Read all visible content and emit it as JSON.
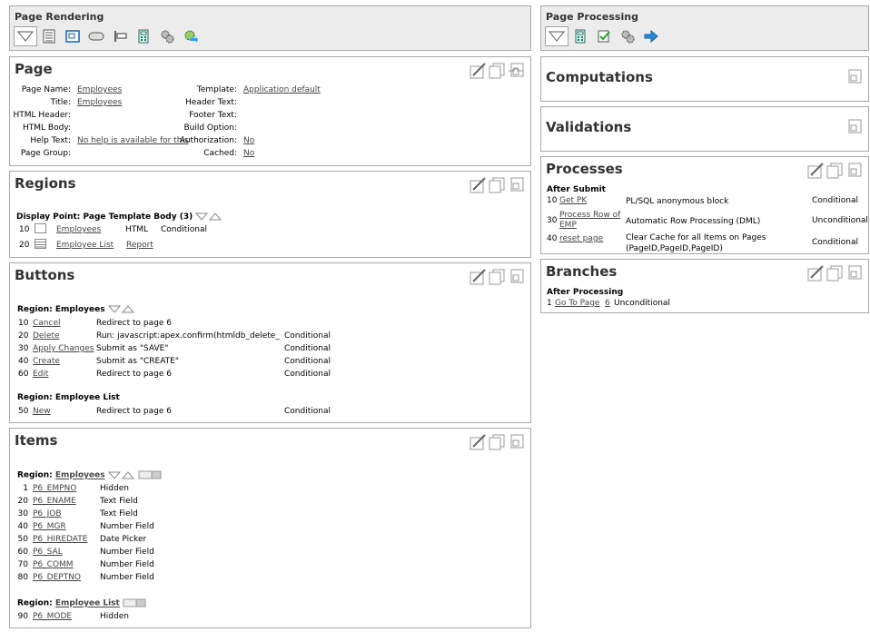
{
  "rendering": {
    "title": "Page Rendering",
    "toolbar_icons": [
      "view-icon",
      "page-list-icon",
      "region-icon",
      "button-icon",
      "item-icon",
      "calculator-icon",
      "gear-icon",
      "shared-components-icon"
    ]
  },
  "processing": {
    "title": "Page Processing",
    "toolbar_icons": [
      "view-icon",
      "calculator-icon",
      "validation-icon",
      "gear-icon",
      "arrow-right-icon"
    ]
  },
  "page": {
    "title": "Page",
    "left": [
      {
        "label": "Page Name:",
        "value": "Employees",
        "link": true
      },
      {
        "label": "Title:",
        "value": "Employees",
        "link": true
      },
      {
        "label": "HTML Header:",
        "value": "",
        "link": false
      },
      {
        "label": "HTML Body:",
        "value": "",
        "link": false
      },
      {
        "label": "Help Text:",
        "value": "No help is available for this",
        "link": true
      },
      {
        "label": "Page Group:",
        "value": "",
        "link": false
      }
    ],
    "right": [
      {
        "label": "Template:",
        "value": "Application default",
        "link": true
      },
      {
        "label": "Header Text:",
        "value": "",
        "link": false
      },
      {
        "label": "Footer Text:",
        "value": "",
        "link": false
      },
      {
        "label": "Build Option:",
        "value": "",
        "link": false
      },
      {
        "label": "Authorization:",
        "value": "No",
        "link": true
      },
      {
        "label": "Cached:",
        "value": "No",
        "link": true
      }
    ]
  },
  "regions": {
    "title": "Regions",
    "display_point": "Display Point: Page Template Body (3)",
    "rows": [
      {
        "seq": "10",
        "name": "Employees",
        "type": "HTML",
        "extra": "Conditional",
        "extra_link": false
      },
      {
        "seq": "20",
        "name": "Employee List",
        "type": "",
        "extra": "Report",
        "extra_link": true
      }
    ]
  },
  "buttons": {
    "title": "Buttons",
    "group1": "Region: Employees",
    "rows1": [
      {
        "seq": "10",
        "name": "Cancel",
        "action": "Redirect to page 6",
        "cond": ""
      },
      {
        "seq": "20",
        "name": "Delete",
        "action": "Run: javascript:apex.confirm(htmldb_delete_me",
        "cond": "Conditional"
      },
      {
        "seq": "30",
        "name": "Apply Changes",
        "action": "Submit as \"SAVE\"",
        "cond": "Conditional"
      },
      {
        "seq": "40",
        "name": "Create",
        "action": "Submit as \"CREATE\"",
        "cond": "Conditional"
      },
      {
        "seq": "60",
        "name": "Edit",
        "action": "Redirect to page 6",
        "cond": "Conditional"
      }
    ],
    "group2": "Region: Employee List",
    "rows2": [
      {
        "seq": "50",
        "name": "New",
        "action": "Redirect to page 6",
        "cond": "Conditional"
      }
    ]
  },
  "items": {
    "title": "Items",
    "group1_prefix": "Region:",
    "group1_name": "Employees",
    "rows1": [
      {
        "seq": "1",
        "name": "P6_EMPNO",
        "type": "Hidden"
      },
      {
        "seq": "20",
        "name": "P6_ENAME",
        "type": "Text Field"
      },
      {
        "seq": "30",
        "name": "P6_JOB",
        "type": "Text Field"
      },
      {
        "seq": "40",
        "name": "P6_MGR",
        "type": "Number Field"
      },
      {
        "seq": "50",
        "name": "P6_HIREDATE",
        "type": "Date Picker"
      },
      {
        "seq": "60",
        "name": "P6_SAL",
        "type": "Number Field"
      },
      {
        "seq": "70",
        "name": "P6_COMM",
        "type": "Number Field"
      },
      {
        "seq": "80",
        "name": "P6_DEPTNO",
        "type": "Number Field"
      }
    ],
    "group2_prefix": "Region:",
    "group2_name": "Employee List",
    "rows2": [
      {
        "seq": "90",
        "name": "P6_MODE",
        "type": "Hidden"
      }
    ]
  },
  "computations": {
    "title": "Computations"
  },
  "validations": {
    "title": "Validations"
  },
  "processes": {
    "title": "Processes",
    "group": "After Submit",
    "rows": [
      {
        "seq": "10",
        "name": "Get PK",
        "type": "PL/SQL anonymous block",
        "cond": "Conditional"
      },
      {
        "seq": "30",
        "name": "Process Row of EMP",
        "type": "Automatic Row Processing (DML)",
        "cond": "Unconditional"
      },
      {
        "seq": "40",
        "name": "reset page",
        "type": "Clear Cache for all Items on Pages (PageID,PageID,PageID)",
        "cond": "Conditional"
      }
    ]
  },
  "branches": {
    "title": "Branches",
    "group": "After Processing",
    "rows": [
      {
        "seq": "1",
        "name": "Go To Page",
        "page": "6",
        "cond": "Unconditional"
      }
    ]
  },
  "colors": {
    "border": "#a8a8a8",
    "toolbar_bg": "#ececec",
    "title": "#333333",
    "link": "#444444"
  }
}
